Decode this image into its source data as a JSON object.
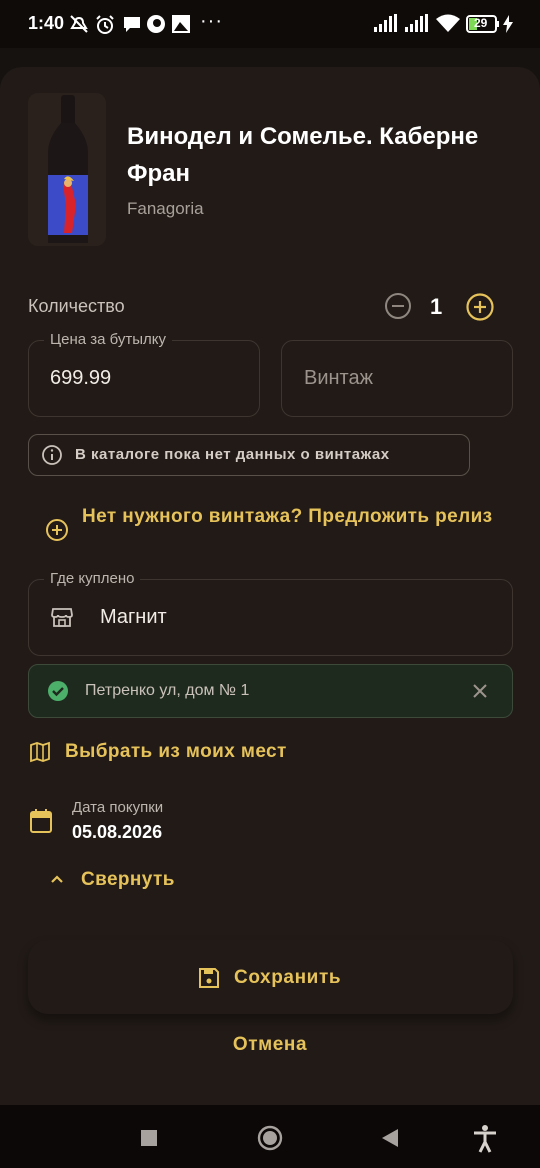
{
  "status_bar": {
    "time": "1:40",
    "dots": "···",
    "battery": "29",
    "icons": [
      "mute-icon",
      "alarm-icon",
      "chat-icon",
      "app-icon",
      "image-icon",
      "signal-icon",
      "signal-icon",
      "wifi-icon",
      "battery-icon",
      "charging-icon"
    ]
  },
  "wine": {
    "name": "Винодел и Сомелье. Каберне Фран",
    "producer": "Fanagoria"
  },
  "quantity": {
    "label": "Количество",
    "value": "1"
  },
  "price": {
    "legend": "Цена за бутылку",
    "value": "699.99"
  },
  "vintage": {
    "placeholder": "Винтаж"
  },
  "vintage_info": "В каталоге пока нет данных о винтажах",
  "suggest_release": "Нет нужного винтажа? Предложить релиз",
  "shop": {
    "legend": "Где куплено",
    "value": "Магнит"
  },
  "address": "Петренко ул, дом № 1",
  "choose_places": "Выбрать из моих мест",
  "purchase_date": {
    "label": "Дата покупки",
    "value": "05.08.2026"
  },
  "collapse": "Свернуть",
  "save": "Сохранить",
  "cancel": "Отмена",
  "colors": {
    "accent": "#e6c25b",
    "sheet": "#211a16",
    "success": "#4caf6a"
  }
}
